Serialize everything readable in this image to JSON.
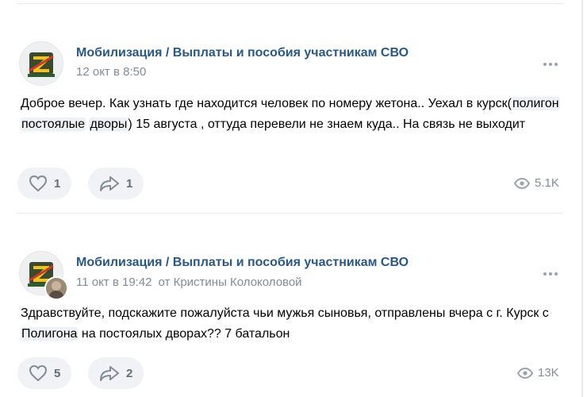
{
  "posts": [
    {
      "group_name": "Мобилизация / Выплаты и пособия участникам СВО",
      "date": "12 окт в 8:50",
      "text_before": "Доброе вечер. Как узнать где находится человек по номеру жетона.. Уехал в курск(",
      "hashtags": [
        "полигон",
        "постоялые",
        "дворы"
      ],
      "text_after": ") 15 августа , оттуда перевели не знаем куда.. На связь не выходит",
      "likes": "1",
      "shares": "1",
      "views": "5.1K"
    },
    {
      "group_name": "Мобилизация / Выплаты и пособия участникам СВО",
      "date": "11 окт в 19:42",
      "author_from": "от Кристины Колоколовой",
      "text_before": "Здравствуйте, подскажите пожалуйста чьи мужья сыновья, отправлены вчера с г. Курск с ",
      "hashtag": "Полигона",
      "text_after": " на постоялых дворах?? 7 батальон",
      "likes": "5",
      "shares": "2",
      "views": "13K"
    }
  ],
  "icons": {
    "like": "heart-icon",
    "share": "share-arrow-icon",
    "views": "eye-icon",
    "more": "more-dots-icon"
  },
  "colors": {
    "link": "#2a5885",
    "meta": "#818c99",
    "button_bg": "#f0f2f5"
  }
}
